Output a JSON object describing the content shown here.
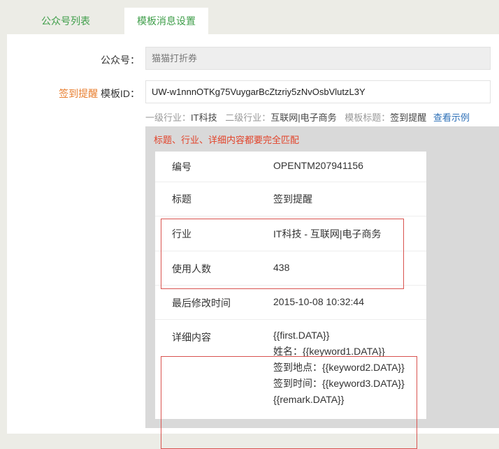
{
  "tabs": [
    {
      "label": "公众号列表",
      "active": false
    },
    {
      "label": "模板消息设置",
      "active": true
    }
  ],
  "form": {
    "account_label": "公众号：",
    "account_value": "猫猫打折券",
    "template_label_prefix": "签到提醒",
    "template_label_suffix": " 模板ID：",
    "template_id_value": "UW-w1nnnOTKg75VuygarBcZtzriy5zNvOsbVlutzL3Y"
  },
  "hint": {
    "industry1_label": "一级行业：",
    "industry1_value": "IT科技",
    "industry2_label": "二级行业：",
    "industry2_value": "互联网|电子商务",
    "template_title_label": "模板标题：",
    "template_title_value": "签到提醒",
    "example_link": "查看示例"
  },
  "warning": "标题、行业、详细内容都要完全匹配",
  "details": {
    "rows": [
      {
        "label": "编号",
        "value": "OPENTM207941156"
      },
      {
        "label": "标题",
        "value": "签到提醒"
      },
      {
        "label": "行业",
        "value": "IT科技 - 互联网|电子商务"
      },
      {
        "label": "使用人数",
        "value": "438"
      },
      {
        "label": "最后修改时间",
        "value": "2015-10-08 10:32:44"
      }
    ],
    "content_label": "详细内容",
    "content_lines": [
      "{{first.DATA}}",
      "姓名：{{keyword1.DATA}}",
      "签到地点：{{keyword2.DATA}}",
      "签到时间：{{keyword3.DATA}}",
      "{{remark.DATA}}"
    ]
  },
  "colors": {
    "accent_green": "#3f9e4a",
    "warning_red": "#e2442b",
    "highlight_border": "#d9534f",
    "label_orange": "#e87e2e",
    "link_blue": "#2c6fb7"
  }
}
